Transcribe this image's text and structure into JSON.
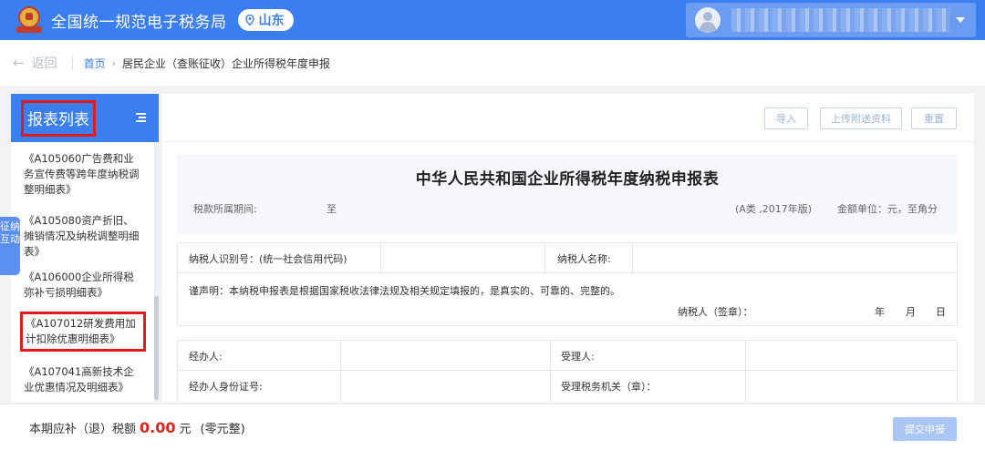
{
  "header": {
    "site_title": "全国统一规范电子税务局",
    "region": "山东",
    "logo_caption": "中国税务"
  },
  "breadcrumb": {
    "back_label": "返回",
    "home": "首页",
    "current": "居民企业（查账征收）企业所得税年度申报"
  },
  "sidebar": {
    "title": "报表列表",
    "items": [
      "《A105060广告费和业务宣传费等跨年度纳税调整明细表》",
      "《A105080资产折旧、摊销情况及纳税调整明细表》",
      "《A106000企业所得税弥补亏损明细表》",
      "《A107012研发费用加计扣除优惠明细表》",
      "《A107041高新技术企业优惠情况及明细表》"
    ]
  },
  "float_tab": "征纳互动",
  "toolbar": {
    "import": "导入",
    "upload": "上传附送资料",
    "reset": "重置"
  },
  "form": {
    "title": "中华人民共和国企业所得税年度纳税申报表",
    "period_label": "税款所属期间:",
    "period_to": "至",
    "version": "(A类 ,2017年版)",
    "currency": "金额单位：元，至角分",
    "taxpayer_id_label": "纳税人识别号：(统一社会信用代码)",
    "taxpayer_name_label": "纳税人名称:",
    "declaration": "谨声明：本纳税申报表是根据国家税收法律法规及相关规定填报的，是真实的、可靠的、完整的。",
    "signature_label": "纳税人（签章）：",
    "year": "年",
    "month": "月",
    "day": "日",
    "agent_label": "经办人:",
    "receiver_label": "受理人:",
    "agent_id_label": "经办人身份证号:",
    "tax_office_label": "受理税务机关（章）："
  },
  "bottom": {
    "label": "本期应补（退）税额",
    "amount": "0.00",
    "unit": "元",
    "words": "(零元整)",
    "submit": "提交申报"
  },
  "colors": {
    "primary": "#3b7ef0",
    "highlight_red": "#e01b1b",
    "amount_red": "#e2231a"
  }
}
